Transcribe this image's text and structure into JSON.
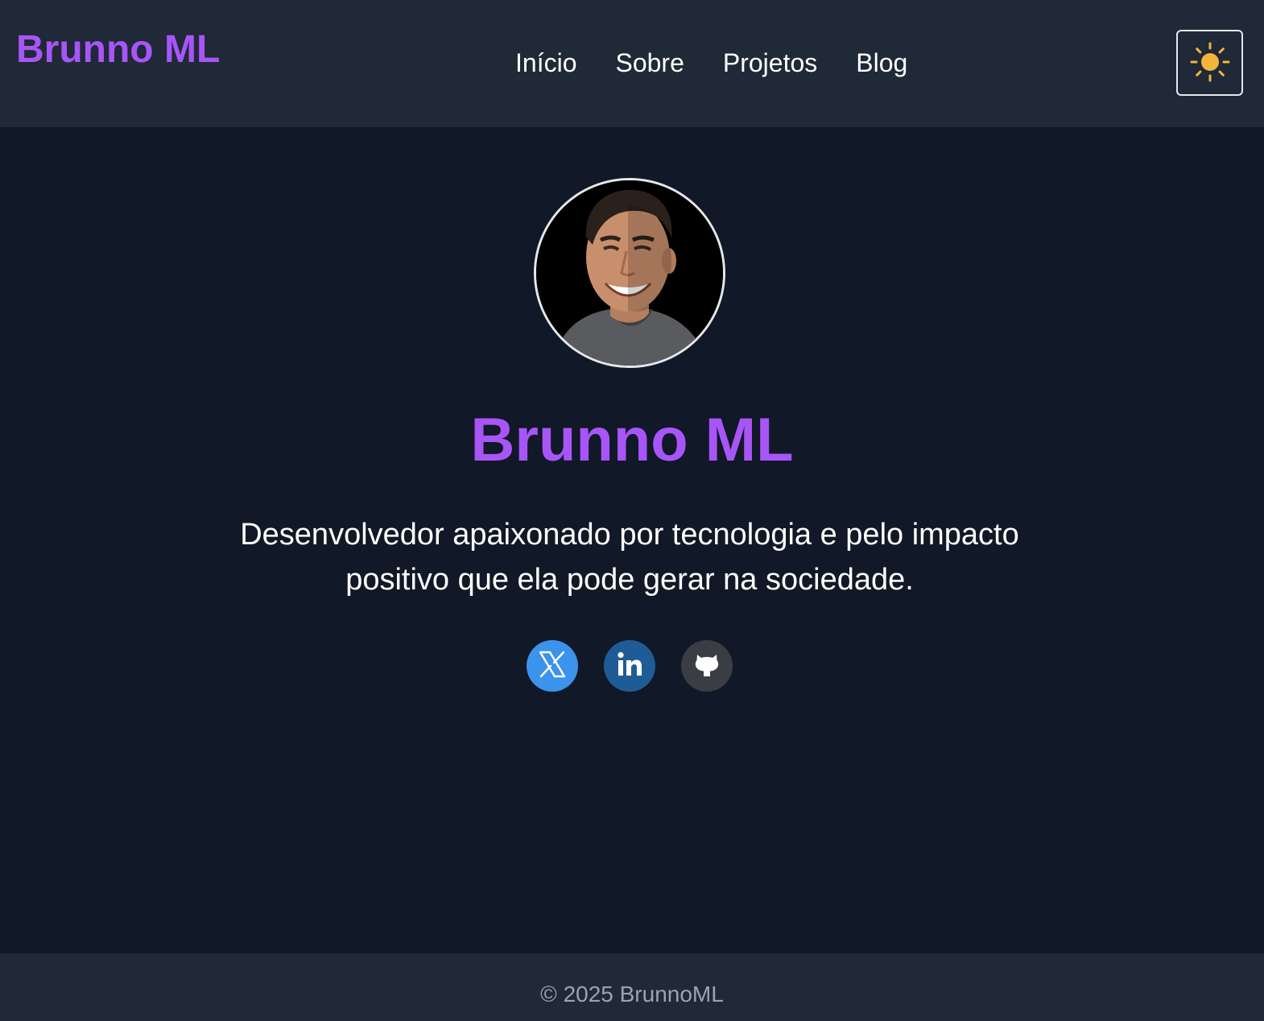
{
  "header": {
    "brand": "Brunno ML",
    "nav": [
      {
        "label": "Início"
      },
      {
        "label": "Sobre"
      },
      {
        "label": "Projetos"
      },
      {
        "label": "Blog"
      }
    ],
    "theme_toggle_icon": "sun-icon"
  },
  "hero": {
    "avatar_icon": "profile-photo",
    "name": "Brunno ML",
    "description": "Desenvolvedor apaixonado por tecnologia e pelo impacto positivo que ela pode gerar na sociedade."
  },
  "socials": [
    {
      "icon": "x-twitter-icon",
      "color": "#3b93ec"
    },
    {
      "icon": "linkedin-icon",
      "color": "#1f5c95"
    },
    {
      "icon": "github-icon",
      "color": "#3a3d43"
    }
  ],
  "footer": {
    "copyright": "© 2025 BrunnoML"
  },
  "colors": {
    "accent": "#a855f7",
    "header_bg": "#1f2937",
    "page_bg": "#111827",
    "sun": "#f2b53c"
  }
}
